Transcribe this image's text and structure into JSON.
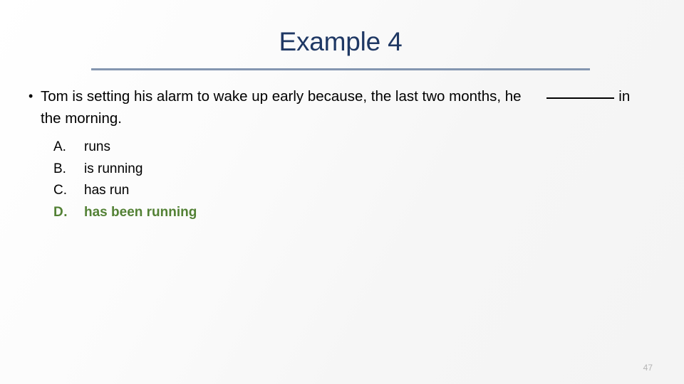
{
  "slide": {
    "title": "Example 4",
    "page_number": "47",
    "accent_rule_color": "#8496B0",
    "title_color": "#1F3864",
    "answer_color": "#538135"
  },
  "question": {
    "bullet_glyph": "•",
    "line1": "Tom is setting his alarm to wake up early because, the last two months, he",
    "blank": "_______",
    "line2_after_blank": "in the morning."
  },
  "choices": [
    {
      "letter": "A.",
      "text": "runs",
      "is_answer": false
    },
    {
      "letter": "B.",
      "text": "is running",
      "is_answer": false
    },
    {
      "letter": "C.",
      "text": "has run",
      "is_answer": false
    },
    {
      "letter": "D.",
      "text": "has been running",
      "is_answer": true
    }
  ]
}
